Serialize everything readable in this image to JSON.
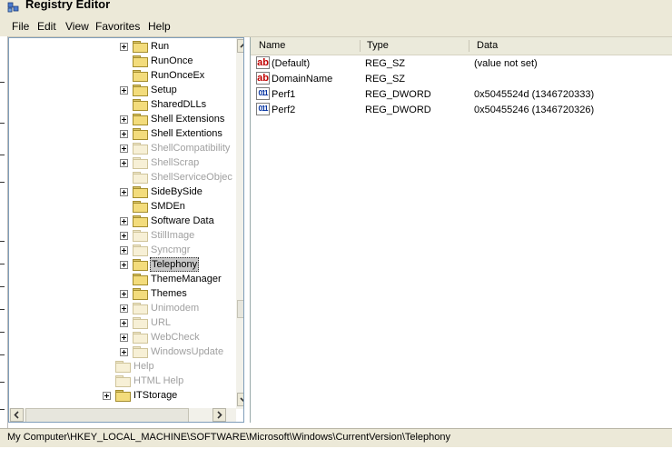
{
  "window": {
    "title": "Registry Editor"
  },
  "menu": [
    "File",
    "Edit",
    "View",
    "Favorites",
    "Help"
  ],
  "tree": {
    "items": [
      {
        "label": "Run",
        "expander": true,
        "dim": false,
        "selected": false,
        "indent": 1
      },
      {
        "label": "RunOnce",
        "expander": false,
        "dim": false,
        "selected": false,
        "indent": 1
      },
      {
        "label": "RunOnceEx",
        "expander": false,
        "dim": false,
        "selected": false,
        "indent": 1
      },
      {
        "label": "Setup",
        "expander": true,
        "dim": false,
        "selected": false,
        "indent": 1
      },
      {
        "label": "SharedDLLs",
        "expander": false,
        "dim": false,
        "selected": false,
        "indent": 1
      },
      {
        "label": "Shell Extensions",
        "expander": true,
        "dim": false,
        "selected": false,
        "indent": 1
      },
      {
        "label": "Shell Extentions",
        "expander": true,
        "dim": false,
        "selected": false,
        "indent": 1
      },
      {
        "label": "ShellCompatibility",
        "expander": true,
        "dim": true,
        "selected": false,
        "indent": 1
      },
      {
        "label": "ShellScrap",
        "expander": true,
        "dim": true,
        "selected": false,
        "indent": 1
      },
      {
        "label": "ShellServiceObjec",
        "expander": false,
        "dim": true,
        "selected": false,
        "indent": 1
      },
      {
        "label": "SideBySide",
        "expander": true,
        "dim": false,
        "selected": false,
        "indent": 1
      },
      {
        "label": "SMDEn",
        "expander": false,
        "dim": false,
        "selected": false,
        "indent": 1
      },
      {
        "label": "Software Data",
        "expander": true,
        "dim": false,
        "selected": false,
        "indent": 1
      },
      {
        "label": "StillImage",
        "expander": true,
        "dim": true,
        "selected": false,
        "indent": 1
      },
      {
        "label": "Syncmgr",
        "expander": true,
        "dim": true,
        "selected": false,
        "indent": 1
      },
      {
        "label": "Telephony",
        "expander": true,
        "dim": false,
        "selected": true,
        "indent": 1
      },
      {
        "label": "ThemeManager",
        "expander": false,
        "dim": false,
        "selected": false,
        "indent": 1
      },
      {
        "label": "Themes",
        "expander": true,
        "dim": false,
        "selected": false,
        "indent": 1
      },
      {
        "label": "Unimodem",
        "expander": true,
        "dim": true,
        "selected": false,
        "indent": 1
      },
      {
        "label": "URL",
        "expander": true,
        "dim": true,
        "selected": false,
        "indent": 1
      },
      {
        "label": "WebCheck",
        "expander": true,
        "dim": true,
        "selected": false,
        "indent": 1
      },
      {
        "label": "WindowsUpdate",
        "expander": true,
        "dim": true,
        "selected": false,
        "indent": 1
      },
      {
        "label": "Help",
        "expander": false,
        "dim": true,
        "selected": false,
        "indent": 0
      },
      {
        "label": "HTML Help",
        "expander": false,
        "dim": true,
        "selected": false,
        "indent": 0
      },
      {
        "label": "ITStorage",
        "expander": true,
        "dim": false,
        "selected": false,
        "indent": 0
      }
    ]
  },
  "columns": {
    "name": "Name",
    "type": "Type",
    "data": "Data"
  },
  "values": [
    {
      "icon": "string-value-icon",
      "name": "(Default)",
      "type": "REG_SZ",
      "data": "(value not set)",
      "kind": "sz"
    },
    {
      "icon": "string-value-icon",
      "name": "DomainName",
      "type": "REG_SZ",
      "data": "",
      "kind": "sz"
    },
    {
      "icon": "binary-value-icon",
      "name": "Perf1",
      "type": "REG_DWORD",
      "data": "0x5045524d (1346720333)",
      "kind": "dw"
    },
    {
      "icon": "binary-value-icon",
      "name": "Perf2",
      "type": "REG_DWORD",
      "data": "0x50455246 (1346720326)",
      "kind": "dw"
    }
  ],
  "statusbar": {
    "path": "My Computer\\HKEY_LOCAL_MACHINE\\SOFTWARE\\Microsoft\\Windows\\CurrentVersion\\Telephony"
  },
  "icons": {
    "sz_glyph": "ab",
    "dw_glyph": "011"
  }
}
